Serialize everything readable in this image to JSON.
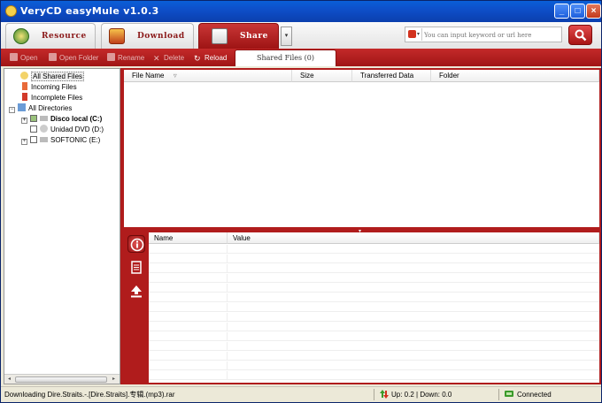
{
  "window": {
    "title": "VeryCD easyMule v1.0.3",
    "minimize": "_",
    "maximize": "□",
    "close": "×"
  },
  "tabs": [
    {
      "label": "Resource"
    },
    {
      "label": "Download"
    },
    {
      "label": "Share"
    }
  ],
  "tab_dropdown": "▾",
  "search": {
    "placeholder": "You can input keyword or url here",
    "engine_arrow": "▾"
  },
  "toolbar": {
    "open": "Open",
    "open_folder": "Open Folder",
    "rename": "Rename",
    "delete": "Delete",
    "reload": "Reload",
    "shared_files_tab": "Shared Files (0)"
  },
  "tree": {
    "all_shared": "All Shared Files",
    "incoming": "Incoming Files",
    "incomplete": "Incomplete Files",
    "all_directories": "All Directories",
    "drives": [
      {
        "label": "Disco local (C:)",
        "checked": true
      },
      {
        "label": "Unidad DVD (D:)",
        "checked": false
      },
      {
        "label": "SOFTONIC (E:)",
        "checked": false
      }
    ],
    "expander": "+",
    "collapser": "−",
    "scroll_left": "◂",
    "scroll_right": "▸"
  },
  "file_list": {
    "columns": [
      "File Name",
      "Size",
      "Transferred Data",
      "Folder"
    ],
    "sort_indicator": "▿"
  },
  "details": {
    "columns": [
      "Name",
      "Value"
    ]
  },
  "statusbar": {
    "message": "Downloading Dire.Straits.-.[Dire.Straits].专辑.(mp3).rar",
    "speed": "Up: 0.2 | Down: 0.0",
    "connection": "Connected"
  },
  "colors": {
    "accent_red": "#b01c1c",
    "title_blue": "#0e4fc9"
  }
}
